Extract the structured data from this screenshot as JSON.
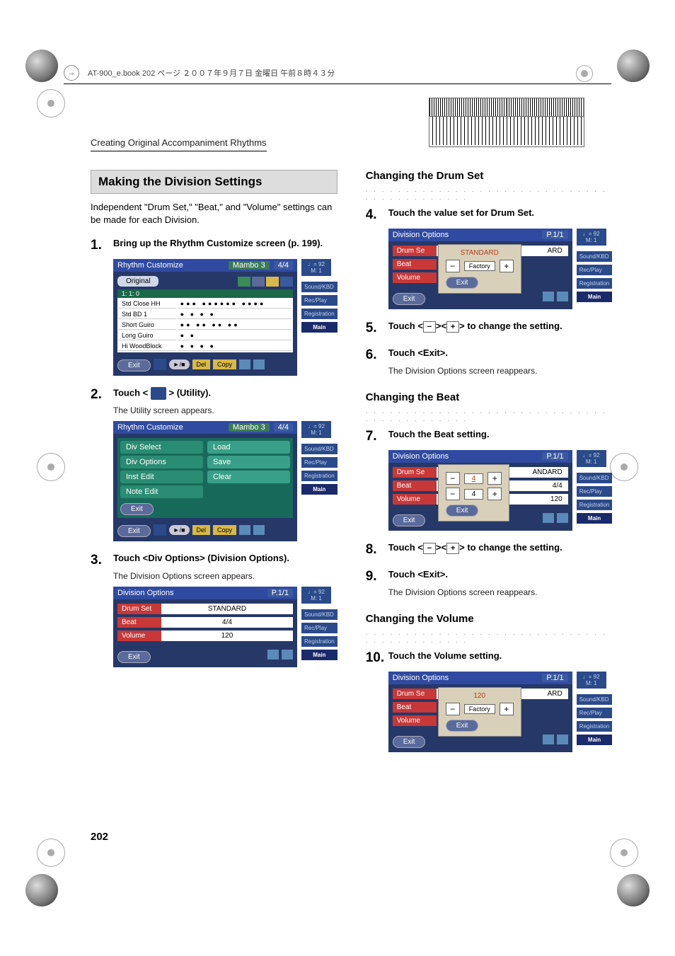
{
  "header": {
    "book_meta": "AT-900_e.book  202 ページ  ２００７年９月７日  金曜日  午前８時４３分"
  },
  "breadcrumb": "Creating Original Accompaniment Rhythms",
  "left": {
    "section_title": "Making the Division Settings",
    "intro": "Independent \"Drum Set,\" \"Beat,\" and \"Volume\" settings can be made for each Division.",
    "steps": {
      "s1": "Bring up the Rhythm Customize screen (p. 199).",
      "s2_a": "Touch <",
      "s2_b": "> (Utility).",
      "s2_desc": "The Utility screen appears.",
      "s3": "Touch <Div Options> (Division Options).",
      "s3_desc": "The Division Options screen appears."
    },
    "lcd_rhythm": {
      "title": "Rhythm Customize",
      "mode": "Mambo 3",
      "time_sig": "4/4",
      "tempo": "♩= 92",
      "measure": "M:    1",
      "original_label": "Original",
      "pos": "1: 1: 0",
      "rows": [
        "Std Close HH",
        "Std BD 1",
        "Short Guiro",
        "Long Guiro",
        "Hi WoodBlock"
      ],
      "btns": {
        "exit": "Exit",
        "play": "►/■",
        "del": "Del",
        "copy": "Copy"
      },
      "side": [
        "Sound/KBD",
        "Rec/Play",
        "Registration",
        "Main"
      ]
    },
    "lcd_utility": {
      "title": "Rhythm Customize",
      "mode": "Mambo 3",
      "time_sig": "4/4",
      "tempo": "♩= 92",
      "measure": "M:    1",
      "left_items": [
        "Div Select",
        "Div Options",
        "Inst Edit",
        "Note Edit"
      ],
      "right_items": [
        "Load",
        "Save",
        "Clear"
      ],
      "exit": "Exit",
      "btns": {
        "exit_bottom": "Exit",
        "play": "►/■",
        "del": "Del",
        "copy": "Copy"
      },
      "side": [
        "Sound/KBD",
        "Rec/Play",
        "Registration",
        "Main"
      ]
    },
    "lcd_div": {
      "title": "Division Options",
      "page": "P.1/1",
      "tempo": "♩= 92",
      "measure": "M:    1",
      "rows": [
        {
          "label": "Drum Set",
          "val": "STANDARD"
        },
        {
          "label": "Beat",
          "val": "4/4"
        },
        {
          "label": "Volume",
          "val": "120"
        }
      ],
      "exit": "Exit",
      "side": [
        "Sound/KBD",
        "Rec/Play",
        "Registration",
        "Main"
      ]
    }
  },
  "right": {
    "sub_drum": "Changing the Drum Set",
    "s4": "Touch the value set for Drum Set.",
    "lcd_drum": {
      "title": "Division Options",
      "page": "P.1/1",
      "tempo": "♩= 92",
      "measure": "M:    1",
      "val": "ARD",
      "popup_val": "STANDARD",
      "factory": "Factory",
      "labels": [
        "Drum Se",
        "Beat",
        "Volume"
      ],
      "exit": "Exit",
      "exit2": "Exit",
      "side": [
        "Sound/KBD",
        "Rec/Play",
        "Registration",
        "Main"
      ]
    },
    "s5_a": "Touch <",
    "s5_b": "><",
    "s5_c": "> to change the setting.",
    "s6": "Touch <Exit>.",
    "s6_desc": "The Division Options screen reappears.",
    "sub_beat": "Changing the Beat",
    "s7": "Touch the Beat setting.",
    "lcd_beat": {
      "title": "Division Options",
      "page": "P.1/1",
      "tempo": "♩= 92",
      "measure": "M:    1",
      "labels": [
        "Drum Se",
        "Beat",
        "Volume"
      ],
      "andard": "ANDARD",
      "r1": "4",
      "r2": "4",
      "beat_val": "4/4",
      "vol_val": "120",
      "exit": "Exit",
      "exit2": "Exit",
      "side": [
        "Sound/KBD",
        "Rec/Play",
        "Registration",
        "Main"
      ]
    },
    "s8_a": "Touch <",
    "s8_b": "><",
    "s8_c": "> to change the setting.",
    "s9": "Touch <Exit>.",
    "s9_desc": "The Division Options screen reappears.",
    "sub_vol": "Changing the Volume",
    "s10": "Touch the Volume setting.",
    "lcd_vol": {
      "title": "Division Options",
      "page": "P.1/1",
      "tempo": "♩= 92",
      "measure": "M:    1",
      "labels": [
        "Drum Se",
        "Beat",
        "Volume"
      ],
      "val": "ARD",
      "popup_val": "120",
      "factory": "Factory",
      "exit": "Exit",
      "exit2": "Exit",
      "side": [
        "Sound/KBD",
        "Rec/Play",
        "Registration",
        "Main"
      ]
    }
  },
  "page_number": "202",
  "dots_row": ". . . . . . . . . . . . . . . . . . . . . . . . . . . . . . . . . . . . . . . . . . ."
}
